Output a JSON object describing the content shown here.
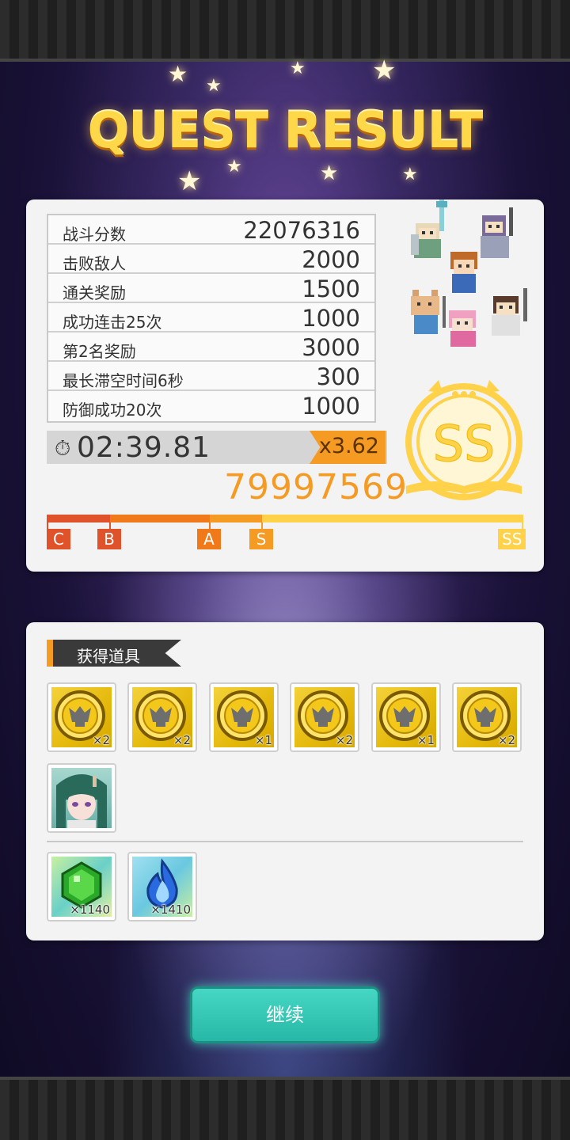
{
  "header": {
    "title": "QUEST RESULT"
  },
  "score_table": {
    "rows": [
      {
        "label": "战斗分数",
        "value": "22076316"
      },
      {
        "label": "击败敌人",
        "value": "2000"
      },
      {
        "label": "通关奖励",
        "value": "1500"
      },
      {
        "label": "成功连击25次",
        "value": "1000"
      },
      {
        "label": "第2名奖励",
        "value": "3000"
      },
      {
        "label": "最长滞空时间6秒",
        "value": "300"
      },
      {
        "label": "防御成功20次",
        "value": "1000"
      }
    ]
  },
  "result": {
    "clear_time": "02:39.81",
    "multiplier": "x3.62",
    "total_score": "79997569",
    "rank": "SS"
  },
  "gauge": {
    "marks": [
      {
        "label": "C",
        "color": "#e0532a"
      },
      {
        "label": "B",
        "color": "#e0532a"
      },
      {
        "label": "A",
        "color": "#f07a1a"
      },
      {
        "label": "S",
        "color": "#f59a22"
      },
      {
        "label": "SS",
        "color": "#ffd24a"
      }
    ]
  },
  "items": {
    "section_title": "获得道具",
    "coin_rewards": [
      {
        "icon": "gold-coin-icon",
        "count": "×2"
      },
      {
        "icon": "gold-coin-icon",
        "count": "×2"
      },
      {
        "icon": "gold-coin-icon",
        "count": "×1"
      },
      {
        "icon": "gold-coin-icon",
        "count": "×2"
      },
      {
        "icon": "gold-coin-icon",
        "count": "×1"
      },
      {
        "icon": "gold-coin-icon",
        "count": "×2"
      }
    ],
    "character_reward": {
      "icon": "character-portrait-icon"
    },
    "resource_rewards": [
      {
        "icon": "green-gem-icon",
        "count": "×1140"
      },
      {
        "icon": "blue-flame-icon",
        "count": "×1410"
      }
    ]
  },
  "footer": {
    "continue_label": "继续"
  },
  "colors": {
    "accent_orange": "#f59a22",
    "rank_gold": "#ffd24a",
    "continue_teal": "#2fc3b1"
  }
}
